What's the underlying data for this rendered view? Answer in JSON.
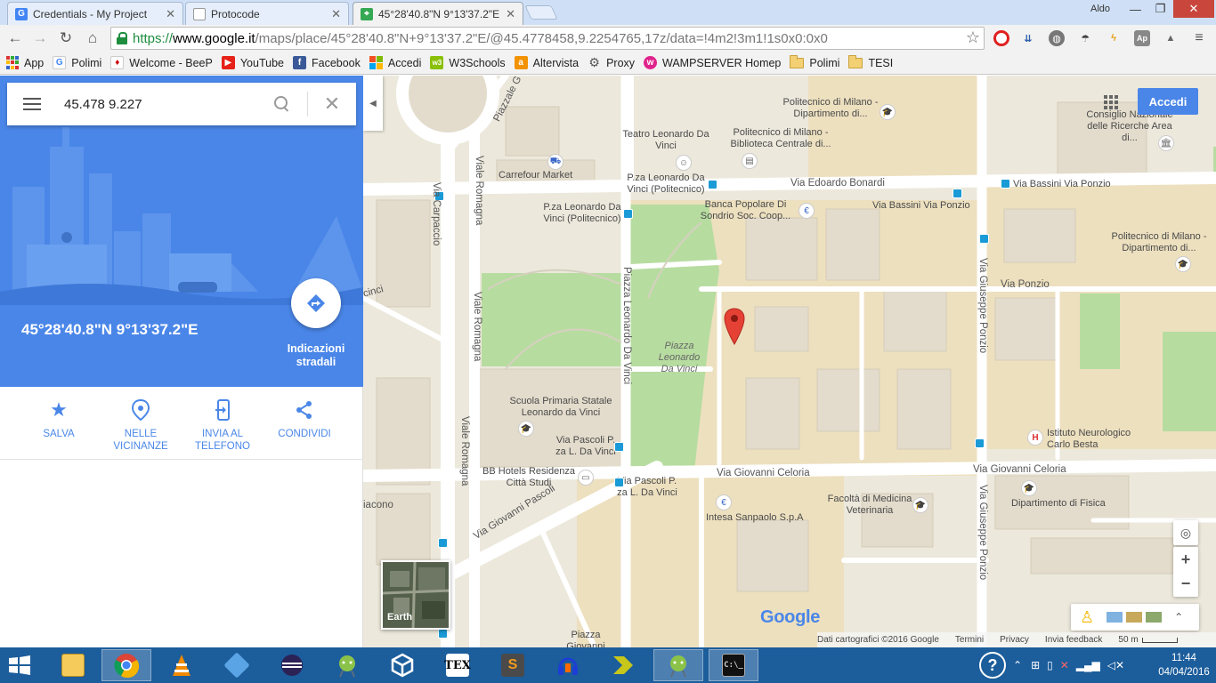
{
  "window": {
    "user": "Aldo",
    "tabs": [
      {
        "label": "Credentials - My Project",
        "favicon": "google-g-icon"
      },
      {
        "label": "Protocode",
        "favicon": "document-icon"
      },
      {
        "label": "45°28'40.8\"N 9°13'37.2\"E",
        "favicon": "google-maps-icon"
      }
    ]
  },
  "toolbar": {
    "url_scheme": "https://",
    "url_host": "www.google.it",
    "url_rest": "/maps/place/45°28'40.8\"N+9°13'37.2\"E/@45.4778458,9.2254765,17z/data=!4m2!3m1!1s0x0:0x0"
  },
  "bookmarks": [
    {
      "label": "App",
      "icon": "apps-grid-icon"
    },
    {
      "label": "Polimi",
      "icon": "google-g-icon"
    },
    {
      "label": "Welcome - BeeP",
      "icon": "beep-icon"
    },
    {
      "label": "YouTube",
      "icon": "youtube-icon"
    },
    {
      "label": "Facebook",
      "icon": "facebook-icon"
    },
    {
      "label": "Accedi",
      "icon": "windows-icon"
    },
    {
      "label": "W3Schools",
      "icon": "w3schools-icon"
    },
    {
      "label": "Altervista",
      "icon": "altervista-icon"
    },
    {
      "label": "Proxy",
      "icon": "gear-icon"
    },
    {
      "label": "WAMPSERVER Homep",
      "icon": "wamp-icon"
    },
    {
      "label": "Polimi",
      "icon": "folder-icon"
    },
    {
      "label": "TESI",
      "icon": "folder-icon"
    }
  ],
  "panel": {
    "search_value": "45.478 9.227",
    "place_title": "45°28'40.8\"N 9°13'37.2\"E",
    "directions_label_1": "Indicazioni",
    "directions_label_2": "stradali",
    "actions": {
      "save": "SALVA",
      "nearby_1": "NELLE",
      "nearby_2": "VICINANZE",
      "send_1": "INVIA AL",
      "send_2": "TELEFONO",
      "share": "CONDIVIDI"
    }
  },
  "map": {
    "signin_label": "Accedi",
    "earth_label": "Earth",
    "logo": "Google",
    "attribution": {
      "data": "Dati cartografici ©2016 Google",
      "terms": "Termini",
      "privacy": "Privacy",
      "feedback": "Invia feedback",
      "scale": "50 m"
    },
    "labels": {
      "piazzale": "Piazzale G",
      "politecnico_dip": "Politecnico di Milano - Dipartimento di...",
      "cnr": "Consiglio Nazionale delle Ricerche Area di...",
      "teatro": "Teatro Leonardo Da Vinci",
      "biblioteca": "Politecnico di Milano - Biblioteca Centrale di...",
      "carrefour": "Carrefour Market",
      "pza_politecnico": "P.za Leonardo Da Vinci (Politecnico)",
      "bonardi": "Via Edoardo Bonardi",
      "bassini_ponzio": "Via Bassini Via Ponzio",
      "banca": "Banca Popolare Di Sondrio Soc. Coop...",
      "bassini_ponzio_2": "Via Bassini Via Ponzio",
      "pza_politecnico_2": "P.za Leonardo Da Vinci (Politecnico)",
      "viale_romagna_top": "Viale Romagna",
      "via_carpaccio": "Via Carpaccio",
      "politecnico_dip_2": "Politecnico di Milano - Dipartimento di...",
      "via_ponzio": "Via Ponzio",
      "piazza_ldv_street": "Piazza Leonardo Da Vinci",
      "piazza_ldv": "Piazza Leonardo Da Vinci",
      "viale_romagna_mid": "Viale Romagna",
      "giuseppe_ponzio": "Via Giuseppe Ponzio",
      "scuola": "Scuola Primaria Statale Leonardo da Vinci",
      "pascoli_stop": "Via Pascoli P. za L. Da Vinci",
      "istituto": "Istituto Neurologico Carlo Besta",
      "bb_hotels": "BB Hotels Residenza Città Studi",
      "celoria": "Via Giovanni Celoria",
      "celoria_2": "Via Giovanni Celoria",
      "pascoli_stop_2": "Via Pascoli P. za L. Da Vinci",
      "viale_romagna_low": "Viale Romagna",
      "fisica": "Dipartimento di Fisica",
      "medicina": "Facoltà di Medicina Veterinaria",
      "intesa": "Intesa Sanpaolo S.p.A",
      "via_pascoli": "Via Giovanni Pascoli",
      "iacono": "iacono",
      "giuseppe_ponzio_2": "Via Giuseppe Ponzio",
      "piazza_giovanni": "Piazza Giovanni",
      "cinci": "cinci"
    }
  },
  "taskbar": {
    "time": "11:44",
    "date": "04/04/2016"
  }
}
